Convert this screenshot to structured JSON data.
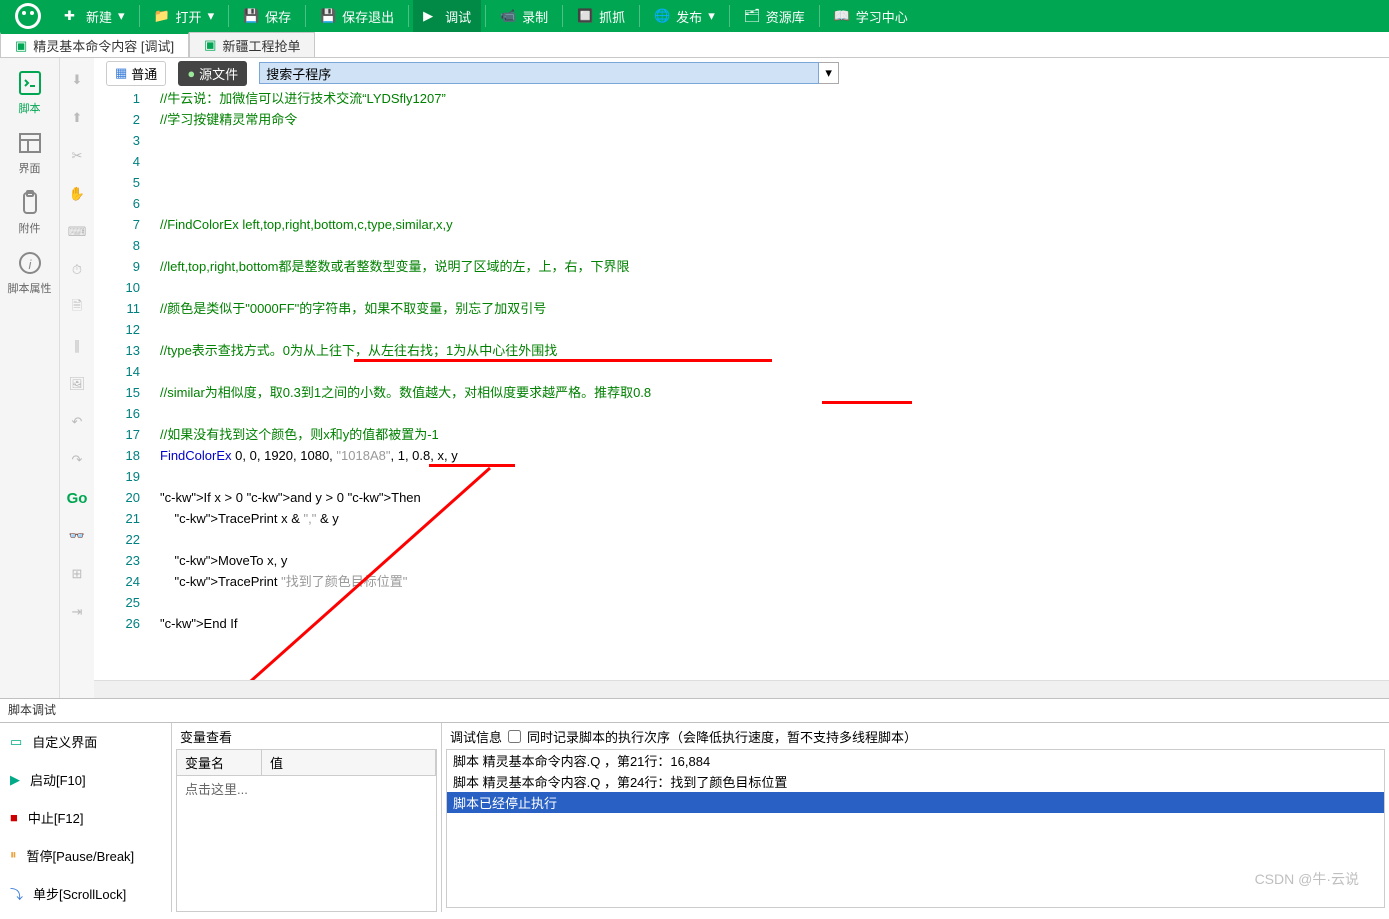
{
  "toolbar": {
    "new": "新建",
    "open": "打开",
    "save": "保存",
    "save_exit": "保存退出",
    "debug": "调试",
    "record": "录制",
    "grab": "抓抓",
    "publish": "发布",
    "reslib": "资源库",
    "study": "学习中心"
  },
  "tabs": [
    {
      "label": "精灵基本命令内容  [调试]",
      "active": true,
      "icon": "doc"
    },
    {
      "label": "新疆工程抢单",
      "active": false,
      "icon": "doc"
    }
  ],
  "sidebar": {
    "script": "脚本",
    "ui": "界面",
    "attach": "附件",
    "props": "脚本属性"
  },
  "editor": {
    "normal_btn": "普通",
    "source_btn": "源文件",
    "search_placeholder": "搜索子程序",
    "search_value": "搜索子程序",
    "go_label": "Go"
  },
  "code_lines": [
    {
      "n": 1,
      "kind": "comment",
      "text": "//牛云说：加微信可以进行技术交流“LYDSfly1207”"
    },
    {
      "n": 2,
      "kind": "comment",
      "text": "//学习按键精灵常用命令"
    },
    {
      "n": 3,
      "kind": "blank",
      "text": ""
    },
    {
      "n": 4,
      "kind": "blank",
      "text": ""
    },
    {
      "n": 5,
      "kind": "blank",
      "text": ""
    },
    {
      "n": 6,
      "kind": "blank",
      "text": ""
    },
    {
      "n": 7,
      "kind": "comment",
      "text": "//FindColorEx left,top,right,bottom,c,type,similar,x,y"
    },
    {
      "n": 8,
      "kind": "blank",
      "text": ""
    },
    {
      "n": 9,
      "kind": "comment",
      "text": "//left,top,right,bottom都是整数或者整数型变量，说明了区域的左，上，右，下界限"
    },
    {
      "n": 10,
      "kind": "blank",
      "text": ""
    },
    {
      "n": 11,
      "kind": "comment",
      "text": "//颜色是类似于\"0000FF\"的字符串，如果不取变量，别忘了加双引号"
    },
    {
      "n": 12,
      "kind": "blank",
      "text": ""
    },
    {
      "n": 13,
      "kind": "comment",
      "text": "//type表示查找方式。0为从上往下，从左往右找；1为从中心往外围找"
    },
    {
      "n": 14,
      "kind": "blank",
      "text": ""
    },
    {
      "n": 15,
      "kind": "comment",
      "text": "//similar为相似度，取0.3到1之间的小数。数值越大，对相似度要求越严格。推荐取0.8"
    },
    {
      "n": 16,
      "kind": "blank",
      "text": ""
    },
    {
      "n": 17,
      "kind": "comment",
      "text": "//如果没有找到这个颜色，则x和y的值都被置为-1"
    },
    {
      "n": 18,
      "kind": "call",
      "text": "FindColorEx 0, 0, 1920, 1080, \"1018A8\", 1, 0.8, x, y"
    },
    {
      "n": 19,
      "kind": "blank",
      "text": ""
    },
    {
      "n": 20,
      "kind": "code",
      "text": "If x > 0 and y > 0 Then"
    },
    {
      "n": 21,
      "kind": "code",
      "text": "    TracePrint x & \",\" & y"
    },
    {
      "n": 22,
      "kind": "blank",
      "text": ""
    },
    {
      "n": 23,
      "kind": "code",
      "text": "    MoveTo x, y"
    },
    {
      "n": 24,
      "kind": "code",
      "text": "    TracePrint \"找到了颜色目标位置\""
    },
    {
      "n": 25,
      "kind": "blank",
      "text": ""
    },
    {
      "n": 26,
      "kind": "code",
      "text": "End If"
    }
  ],
  "debug": {
    "title": "脚本调试",
    "custom_ui": "自定义界面",
    "start": "启动[F10]",
    "stop": "中止[F12]",
    "pause": "暂停[Pause/Break]",
    "step": "单步[ScrollLock]",
    "var_watch": "变量查看",
    "var_name": "变量名",
    "var_value": "值",
    "var_hint": "点击这里...",
    "info_title": "调试信息",
    "info_checkbox": "同时记录脚本的执行次序（会降低执行速度，暂不支持多线程脚本）",
    "lines": [
      "脚本 精灵基本命令内容.Q ，第21行：16,884",
      "脚本 精灵基本命令内容.Q ，第24行：找到了颜色目标位置",
      "脚本已经停止执行"
    ]
  },
  "watermark": "CSDN @牛·云说"
}
